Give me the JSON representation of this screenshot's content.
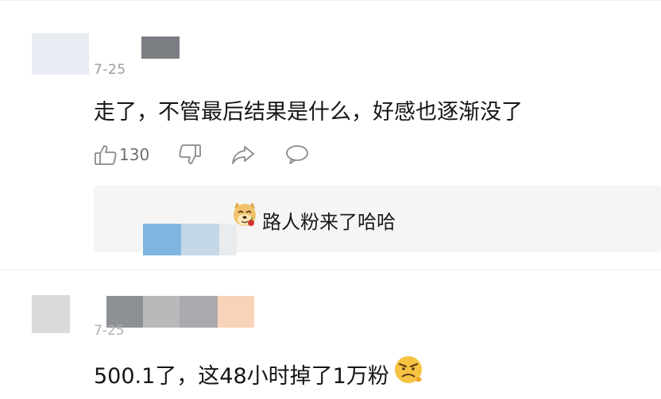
{
  "comments": [
    {
      "date": "7-25",
      "text": "走了，不管最后结果是什么，好感也逐渐没了",
      "actions": {
        "like_count": "130",
        "icons": [
          "thumbs-up-icon",
          "thumbs-down-icon",
          "share-icon",
          "comment-icon"
        ]
      },
      "reply": {
        "emoji": "doge-emoji",
        "text": "路人粉来了哈哈"
      }
    },
    {
      "date": "7-25",
      "text": "500.1了，这48小时掉了1万粉",
      "emoji": "angry-face-emoji"
    }
  ],
  "colors": {
    "text": "#151515",
    "muted": "#9a9a9a",
    "reply_background": "#f5f5f5",
    "icon": "#8a8a8a"
  }
}
